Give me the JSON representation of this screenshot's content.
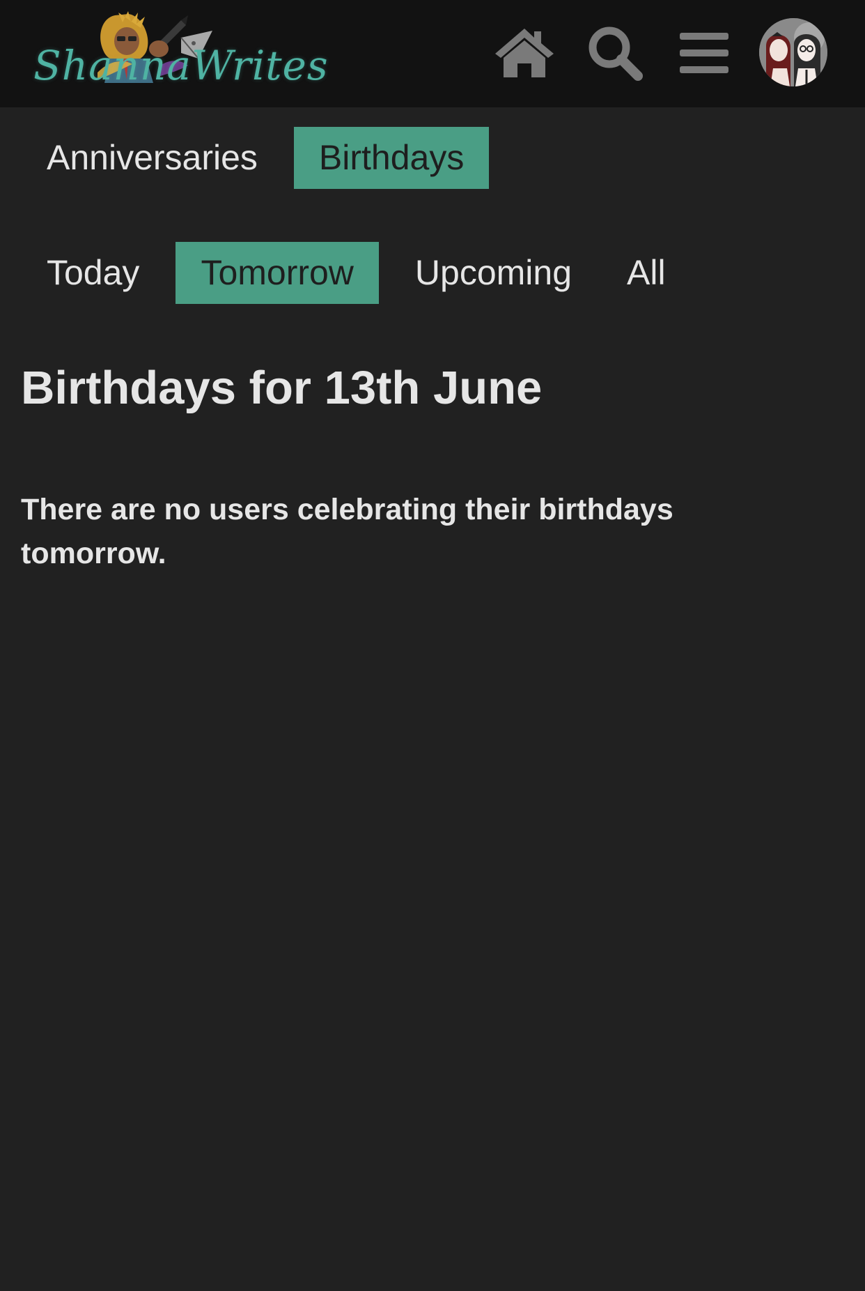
{
  "header": {
    "logo_text": "ShannaWrites",
    "icons": [
      "home-icon",
      "search-icon",
      "menu-icon"
    ],
    "avatar": "user-avatar"
  },
  "category_tabs": [
    {
      "label": "Anniversaries",
      "active": false
    },
    {
      "label": "Birthdays",
      "active": true
    }
  ],
  "period_tabs": [
    {
      "label": "Today",
      "active": false
    },
    {
      "label": "Tomorrow",
      "active": true
    },
    {
      "label": "Upcoming",
      "active": false
    },
    {
      "label": "All",
      "active": false
    }
  ],
  "main": {
    "title": "Birthdays for 13th June",
    "message": "There are no users celebrating their birthdays tomorrow."
  },
  "colors": {
    "accent": "#4a9e85",
    "background": "#212121",
    "header_bg": "#121212",
    "text": "#e6e6e6",
    "icon": "#7a7a7a"
  }
}
